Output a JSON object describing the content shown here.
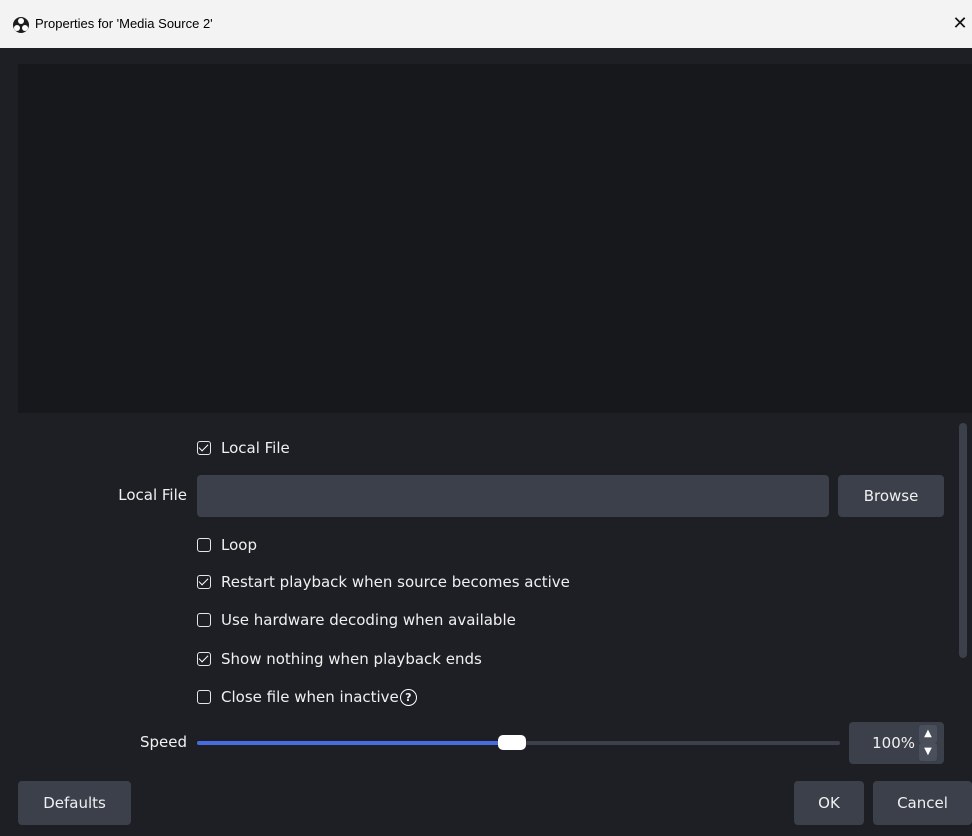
{
  "window": {
    "title": "Properties for 'Media Source 2'",
    "close_glyph": "✕"
  },
  "props": {
    "local_file_checkbox": {
      "label": "Local File",
      "checked": true
    },
    "local_file_field": {
      "label": "Local File",
      "value": "",
      "browse_label": "Browse"
    },
    "loop": {
      "label": "Loop",
      "checked": false
    },
    "restart": {
      "label": "Restart playback when source becomes active",
      "checked": true
    },
    "hw_decoding": {
      "label": "Use hardware decoding when available",
      "checked": false
    },
    "show_nothing": {
      "label": "Show nothing when playback ends",
      "checked": true
    },
    "close_inactive": {
      "label": "Close file when inactive",
      "checked": false,
      "help_icon": "?"
    },
    "speed": {
      "label": "Speed",
      "value_text": "100%",
      "fraction": 0.49
    }
  },
  "footer": {
    "defaults_label": "Defaults",
    "ok_label": "OK",
    "cancel_label": "Cancel"
  },
  "colors": {
    "background": "#1e1f24",
    "preview": "#17181c",
    "control": "#3c404b",
    "accent": "#476be0"
  },
  "icons": [
    "obs-logo-icon",
    "close-icon",
    "checkbox-icon",
    "help-icon",
    "chevron-up-icon",
    "chevron-down-icon"
  ]
}
